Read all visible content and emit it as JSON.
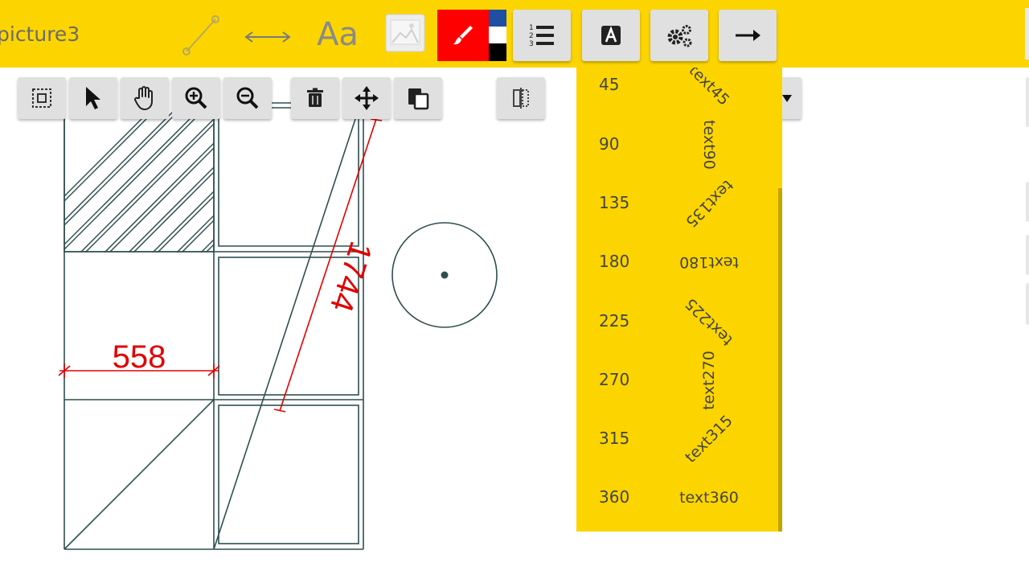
{
  "header": {
    "title": "picture3",
    "text_tool_label": "Aa"
  },
  "icons": {
    "line_tool": "line-tool-icon",
    "dimension_tool": "dimension-tool-icon",
    "text_tool": "text-tool-icon",
    "image_tool": "image-icon",
    "paint_brush": "paint-brush-icon",
    "numbered_list": "numbered-list-icon",
    "font": "font-icon",
    "settings": "settings-icon",
    "arrow": "arrow-right-icon"
  },
  "colors": {
    "toolbar_bg": "#fcd500",
    "active_color": "#ff0000",
    "dimension_color": "#e00000",
    "drawing_color": "#2f4f4f",
    "swatch_top": "#1d4fa3",
    "swatch_middle": "#ffffff",
    "swatch_bottom": "#000000"
  },
  "drawing": {
    "dimension_horizontal": "558",
    "dimension_diagonal": "1744"
  },
  "rotation_list": {
    "items": [
      {
        "angle": "45",
        "sample": "text45"
      },
      {
        "angle": "90",
        "sample": "text90"
      },
      {
        "angle": "135",
        "sample": "text135"
      },
      {
        "angle": "180",
        "sample": "text180"
      },
      {
        "angle": "225",
        "sample": "text225"
      },
      {
        "angle": "270",
        "sample": "text270"
      },
      {
        "angle": "315",
        "sample": "text315"
      },
      {
        "angle": "360",
        "sample": "text360"
      }
    ]
  }
}
